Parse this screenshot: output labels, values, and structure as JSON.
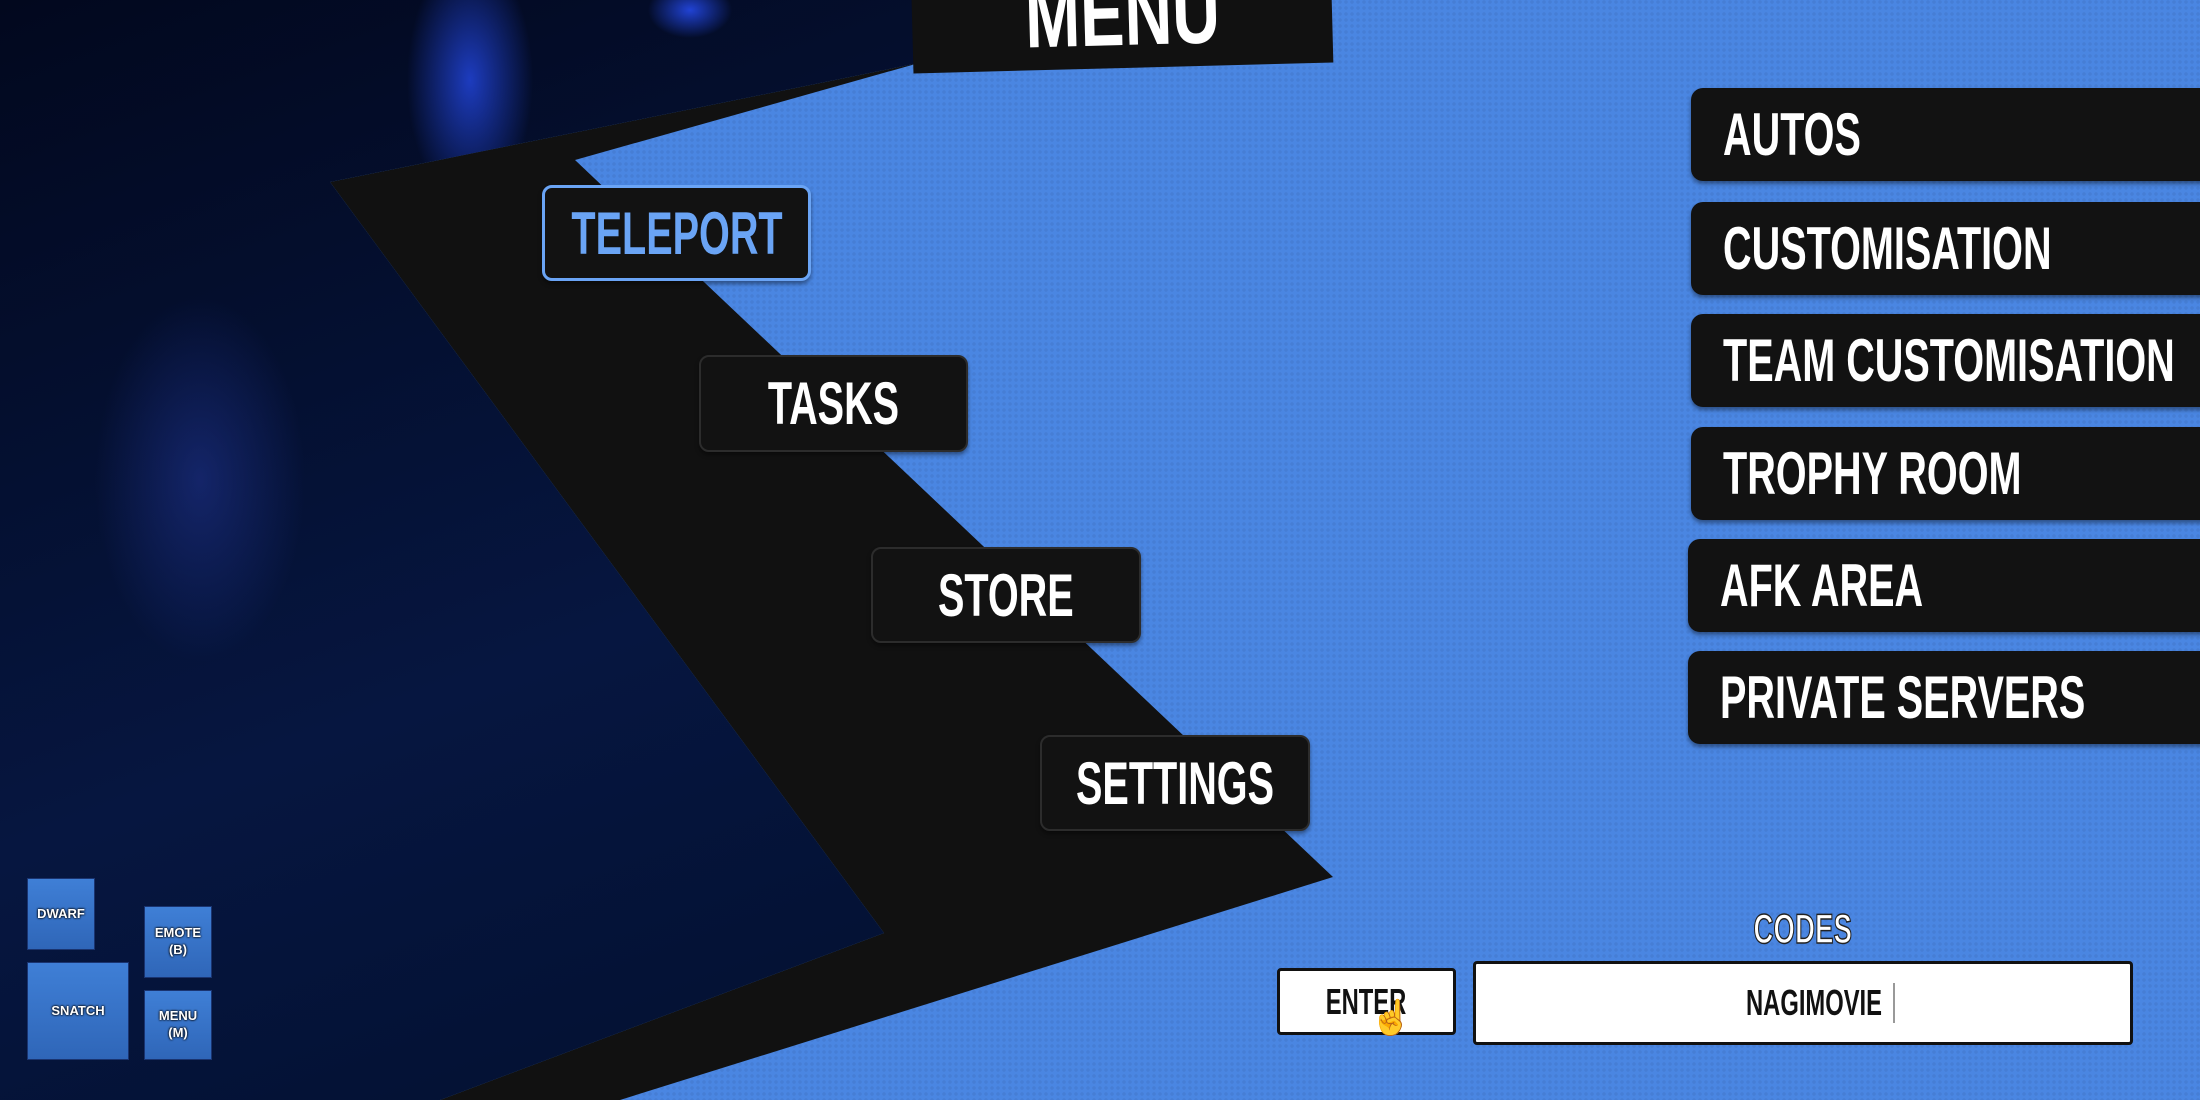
{
  "menu": {
    "title": "MENU"
  },
  "left_menu": [
    {
      "label": "TELEPORT",
      "active": true
    },
    {
      "label": "TASKS",
      "active": false
    },
    {
      "label": "STORE",
      "active": false
    },
    {
      "label": "SETTINGS",
      "active": false
    }
  ],
  "right_menu": [
    {
      "label": "AUTOS"
    },
    {
      "label": "CUSTOMISATION"
    },
    {
      "label": "TEAM CUSTOMISATION"
    },
    {
      "label": "TROPHY ROOM"
    },
    {
      "label": "AFK AREA"
    },
    {
      "label": "PRIVATE SERVERS"
    }
  ],
  "codes": {
    "label": "CODES",
    "enter_label": "ENTER",
    "value": "NAGIMOVIE"
  },
  "hud": {
    "dwarf": "DWARF",
    "snatch": "SNATCH",
    "emote": "EMOTE",
    "emote_key": "(B)",
    "menu": "MENU",
    "menu_key": "(M)"
  },
  "colors": {
    "background": "#4a86e2",
    "panel": "#111111",
    "active_text": "#6aa4f5"
  },
  "icons": {
    "cursor": "hand-pointer-icon"
  }
}
